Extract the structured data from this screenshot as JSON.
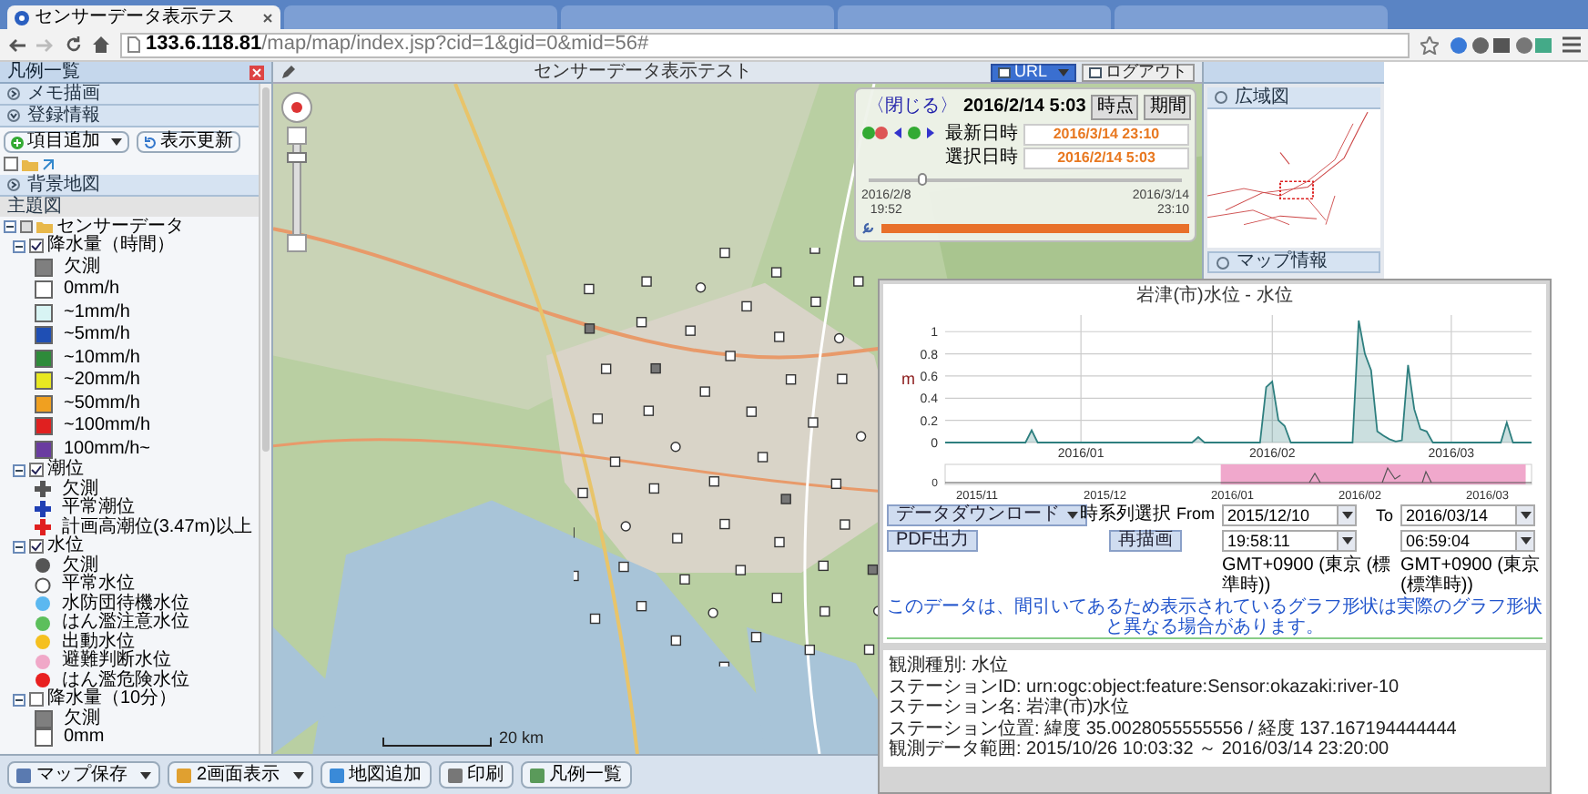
{
  "browser": {
    "tabs": [
      {
        "title": "センサーデータ表示テス",
        "selected": true
      },
      {
        "selected": false
      },
      {
        "selected": false
      },
      {
        "selected": false
      },
      {
        "selected": false
      }
    ],
    "address": "**133.6.118.81**/map/map/index.jsp?cid=1&gid=0&mid=56#"
  },
  "legend_panel": {
    "title": "凡例一覧",
    "sections": [
      {
        "label": "メモ描画",
        "expanded": false
      },
      {
        "label": "登録情報",
        "expanded": true,
        "buttons": [
          {
            "label": "項目追加",
            "dropdown": true
          },
          {
            "label": "表示更新",
            "dropdown": false
          }
        ],
        "item_checked": false
      },
      {
        "label": "背景地図",
        "expanded": false
      }
    ],
    "theme_label": "主題図",
    "tree": [
      {
        "label": "センサーデータ",
        "expanded": true,
        "children": [
          {
            "label": "降水量（時間）",
            "checked": true,
            "expanded": true,
            "children": [
              {
                "label": "欠測",
                "kind": "square",
                "color": "#7f7f7f"
              },
              {
                "label": "0mm/h",
                "kind": "square",
                "color": "#ffffff"
              },
              {
                "label": "~1mm/h",
                "kind": "square",
                "color": "#d8f4f4"
              },
              {
                "label": "~5mm/h",
                "kind": "square",
                "color": "#1f4fb4"
              },
              {
                "label": "~10mm/h",
                "kind": "square",
                "color": "#2e8b3a"
              },
              {
                "label": "~20mm/h",
                "kind": "square",
                "color": "#e8e821"
              },
              {
                "label": "~50mm/h",
                "kind": "square",
                "color": "#f0a020"
              },
              {
                "label": "~100mm/h",
                "kind": "square",
                "color": "#e02020"
              },
              {
                "label": "100mm/h~",
                "kind": "square",
                "color": "#6a3ca0"
              }
            ]
          },
          {
            "label": "潮位",
            "checked": true,
            "expanded": true,
            "children": [
              {
                "label": "欠測",
                "kind": "cross",
                "color": "#555555"
              },
              {
                "label": "平常潮位",
                "kind": "cross",
                "color": "#1f3fb4"
              },
              {
                "label": "計画高潮位(3.47m)以上",
                "kind": "cross",
                "color": "#e02020"
              }
            ]
          },
          {
            "label": "水位",
            "checked": true,
            "expanded": true,
            "children": [
              {
                "label": "欠測",
                "kind": "circle",
                "color": "#555555"
              },
              {
                "label": "平常水位",
                "kind": "ring",
                "color": "#555555"
              },
              {
                "label": "水防団待機水位",
                "kind": "circle",
                "color": "#5bb8f0"
              },
              {
                "label": "はん濫注意水位",
                "kind": "circle",
                "color": "#5cbf5c"
              },
              {
                "label": "出動水位",
                "kind": "circle",
                "color": "#f5c020"
              },
              {
                "label": "避難判断水位",
                "kind": "circle",
                "color": "#f0a8c8"
              },
              {
                "label": "はん濫危険水位",
                "kind": "circle",
                "color": "#e82020"
              }
            ]
          },
          {
            "label": "降水量（10分）",
            "checked": false,
            "expanded": true,
            "children": [
              {
                "label": "欠測",
                "kind": "square",
                "color": "#7f7f7f"
              },
              {
                "label": "0mm",
                "kind": "square",
                "color": "#ffffff"
              }
            ]
          }
        ]
      }
    ]
  },
  "map": {
    "title": "センサーデータ表示テスト",
    "buttons": [
      {
        "label": "URL",
        "dropdown": true
      },
      {
        "label": "ログアウト",
        "dropdown": false
      }
    ],
    "scale": "20 km"
  },
  "time_panel": {
    "close": "〈閉じる〉",
    "datetime": "2016/2/14 5:03",
    "modes": [
      "時点",
      "期間"
    ],
    "fields": [
      {
        "label": "最新日時",
        "value": "2016/3/14 23:10"
      },
      {
        "label": "選択日時",
        "value": "2016/2/14 5:03"
      }
    ],
    "slider": {
      "level": 0.17
    },
    "start": [
      "2016/2/8",
      "19:52"
    ],
    "end": [
      "2016/3/14",
      "23:10"
    ],
    "progress": {
      "level": 1
    }
  },
  "overview": {
    "title": "広域図"
  },
  "map_info": {
    "title": "マップ情報"
  },
  "toolbar": [
    {
      "label": "マップ保存",
      "dropdown": true
    },
    {
      "label": "2画面表示",
      "dropdown": true
    },
    {
      "label": "地図追加",
      "dropdown": false
    },
    {
      "label": "印刷",
      "dropdown": false
    },
    {
      "label": "凡例一覧",
      "dropdown": false
    }
  ],
  "popup": {
    "chart_data": {
      "type": "area",
      "title": "岩津(市)水位 - 水位",
      "ylabel": "m",
      "categories": [
        null,
        null,
        null,
        null,
        null,
        null,
        null,
        null,
        null,
        null,
        null,
        null,
        null,
        null,
        null,
        null,
        null,
        null,
        null,
        null,
        null,
        null,
        "2016/01",
        null,
        null,
        null,
        null,
        null,
        null,
        null,
        null,
        null,
        null,
        null,
        null,
        null,
        null,
        null,
        null,
        null,
        null,
        null,
        null,
        null,
        null,
        null,
        null,
        null,
        null,
        null,
        null,
        null,
        null,
        "2016/02",
        null,
        null,
        null,
        null,
        null,
        null,
        null,
        null,
        null,
        null,
        null,
        null,
        null,
        null,
        null,
        null,
        null,
        null,
        null,
        null,
        null,
        null,
        null,
        null,
        null,
        null,
        null,
        null,
        "2016/03",
        null,
        null,
        null,
        null,
        null,
        null,
        null,
        null,
        null,
        null,
        null,
        null,
        null
      ],
      "series": [
        {
          "color": "#2e7f7f",
          "values": [
            0,
            0,
            0,
            0,
            0,
            0,
            0,
            0,
            0,
            0,
            0,
            0,
            0,
            0,
            0.11,
            0,
            0,
            0,
            0,
            0,
            0,
            0,
            0,
            0,
            0,
            0,
            0,
            0,
            0,
            0,
            0,
            0,
            0,
            0,
            0,
            0,
            0,
            0,
            0,
            0,
            0,
            0.05,
            0,
            0,
            0,
            0,
            0,
            0,
            0,
            0,
            0,
            0,
            0.5,
            0.55,
            0.2,
            0.15,
            0,
            0,
            0,
            0,
            0,
            0,
            0,
            0,
            0,
            0,
            0,
            1.1,
            0.8,
            0.65,
            0.1,
            0.06,
            0.03,
            0.01,
            0.02,
            0.7,
            0.3,
            0.12,
            0.1,
            0,
            0,
            0,
            0,
            0,
            0,
            0,
            0,
            0,
            0,
            0,
            0,
            0.18,
            0,
            0,
            0,
            0
          ]
        }
      ],
      "ylim": [
        0,
        1.15
      ],
      "yticks": [
        0,
        0.2,
        0.4,
        0.6,
        0.8,
        1
      ],
      "grid": true
    },
    "navigator": {
      "ytick": "0",
      "labels": [
        "2015/11",
        "2015/12",
        "2016/01",
        "2016/02",
        "2016/03"
      ]
    },
    "download": {
      "label": "データダウンロード",
      "dropdown": true
    },
    "range_label": "時系列選択",
    "from_label": "From",
    "to_label": "To",
    "from_date": "2015/12/10",
    "to_date": "2016/03/14",
    "from_time": "19:58:11",
    "to_time": "06:59:04",
    "pdf": "PDF出力",
    "redraw": "再描画",
    "timezones": [
      "GMT+0900 (東京 (標準時))",
      "GMT+0900 (東京 (標準時))"
    ],
    "note": "このデータは、間引いてあるため表示されているグラフ形状は実際のグラフ形状と異なる場合があります。",
    "info": [
      "観測種別: 水位",
      "ステーションID: urn:ogc:object:feature:Sensor:okazaki:river-10",
      "ステーション名: 岩津(市)水位",
      "ステーション位置: 緯度 35.0028055555556 / 経度 137.167194444444",
      "観測データ範囲: 2015/10/26 10:03:32 ～ 2016/03/14 23:20:00"
    ]
  }
}
